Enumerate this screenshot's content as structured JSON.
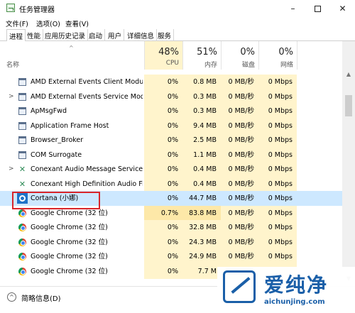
{
  "window": {
    "title": "任务管理器",
    "minimize_glyph": "–",
    "close_glyph": "✕"
  },
  "menu": [
    "文件(F)",
    "选项(O)",
    "查看(V)"
  ],
  "tabs": [
    "进程",
    "性能",
    "应用历史记录",
    "启动",
    "用户",
    "详细信息",
    "服务"
  ],
  "header": {
    "sort_glyph": "^",
    "name_label": "名称",
    "columns": [
      {
        "pct": "48%",
        "label": "CPU"
      },
      {
        "pct": "51%",
        "label": "内存"
      },
      {
        "pct": "0%",
        "label": "磁盘"
      },
      {
        "pct": "0%",
        "label": "网络"
      }
    ]
  },
  "rows": [
    {
      "name": "AMD External Events Client Module",
      "cpu": "0%",
      "mem": "0.8 MB",
      "disk": "0 MB/秒",
      "net": "0 Mbps",
      "expand": "",
      "icon": "window-icon"
    },
    {
      "name": "AMD External Events Service Mod...",
      "cpu": "0%",
      "mem": "0.3 MB",
      "disk": "0 MB/秒",
      "net": "0 Mbps",
      "expand": ">",
      "icon": "window-icon"
    },
    {
      "name": "ApMsgFwd",
      "cpu": "0%",
      "mem": "0.3 MB",
      "disk": "0 MB/秒",
      "net": "0 Mbps",
      "expand": "",
      "icon": "window-icon"
    },
    {
      "name": "Application Frame Host",
      "cpu": "0%",
      "mem": "9.4 MB",
      "disk": "0 MB/秒",
      "net": "0 Mbps",
      "expand": "",
      "icon": "window-icon"
    },
    {
      "name": "Browser_Broker",
      "cpu": "0%",
      "mem": "2.5 MB",
      "disk": "0 MB/秒",
      "net": "0 Mbps",
      "expand": "",
      "icon": "window-icon"
    },
    {
      "name": "COM Surrogate",
      "cpu": "0%",
      "mem": "1.1 MB",
      "disk": "0 MB/秒",
      "net": "0 Mbps",
      "expand": "",
      "icon": "window-icon"
    },
    {
      "name": "Conexant Audio Message Service",
      "cpu": "0%",
      "mem": "0.4 MB",
      "disk": "0 MB/秒",
      "net": "0 Mbps",
      "expand": ">",
      "icon": "conexant-icon"
    },
    {
      "name": "Conexant High Definition Audio Fil...",
      "cpu": "0%",
      "mem": "0.4 MB",
      "disk": "0 MB/秒",
      "net": "0 Mbps",
      "expand": "",
      "icon": "conexant-icon"
    },
    {
      "name": "Cortana (小娜)",
      "cpu": "0%",
      "mem": "44.7 MB",
      "disk": "0 MB/秒",
      "net": "0 Mbps",
      "expand": "",
      "icon": "cortana-icon",
      "selected": true
    },
    {
      "name": "Google Chrome (32 位)",
      "cpu": "0.7%",
      "mem": "83.8 MB",
      "disk": "0 MB/秒",
      "net": "0 Mbps",
      "expand": "",
      "icon": "chrome-icon",
      "hot": true
    },
    {
      "name": "Google Chrome (32 位)",
      "cpu": "0%",
      "mem": "32.8 MB",
      "disk": "0 MB/秒",
      "net": "0 Mbps",
      "expand": "",
      "icon": "chrome-icon"
    },
    {
      "name": "Google Chrome (32 位)",
      "cpu": "0%",
      "mem": "24.3 MB",
      "disk": "0 MB/秒",
      "net": "0 Mbps",
      "expand": "",
      "icon": "chrome-icon"
    },
    {
      "name": "Google Chrome (32 位)",
      "cpu": "0%",
      "mem": "24.9 MB",
      "disk": "0 MB/秒",
      "net": "0 Mbps",
      "expand": "",
      "icon": "chrome-icon"
    },
    {
      "name": "Google Chrome (32 位)",
      "cpu": "0%",
      "mem": "7.7 M",
      "disk": "",
      "net": "",
      "expand": "",
      "icon": "chrome-icon"
    }
  ],
  "footer": {
    "label": "简略信息(D)",
    "glyph": "^"
  },
  "watermark": {
    "brand": "爱纯净",
    "url": "aichunjing.com",
    "color": "#1a5fa8"
  },
  "colors": {
    "cpu_tint": "#fff4cc",
    "selection": "#cde8ff",
    "highlight_border": "#d9262b"
  }
}
